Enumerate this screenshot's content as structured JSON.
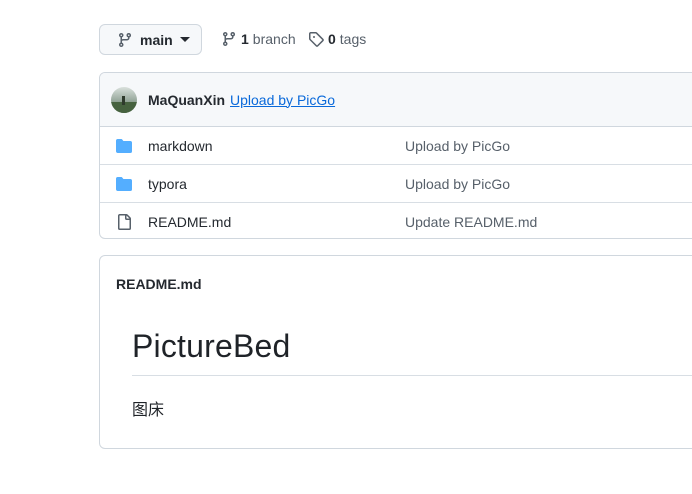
{
  "toolbar": {
    "branch_name": "main",
    "branch_count": "1",
    "branch_label": "branch",
    "tag_count": "0",
    "tag_label": "tags"
  },
  "latest_commit": {
    "author": "MaQuanXin",
    "message": "Upload by PicGo"
  },
  "files": [
    {
      "name": "markdown",
      "type": "folder",
      "message": "Upload by PicGo"
    },
    {
      "name": "typora",
      "type": "folder",
      "message": "Upload by PicGo"
    },
    {
      "name": "README.md",
      "type": "file",
      "message": "Update README.md"
    }
  ],
  "readme": {
    "header": "README.md",
    "heading": "PictureBed",
    "body": "图床"
  },
  "colors": {
    "link": "#0969da",
    "folder": "#54aeff",
    "border": "#d0d7de",
    "muted": "#57606a"
  }
}
